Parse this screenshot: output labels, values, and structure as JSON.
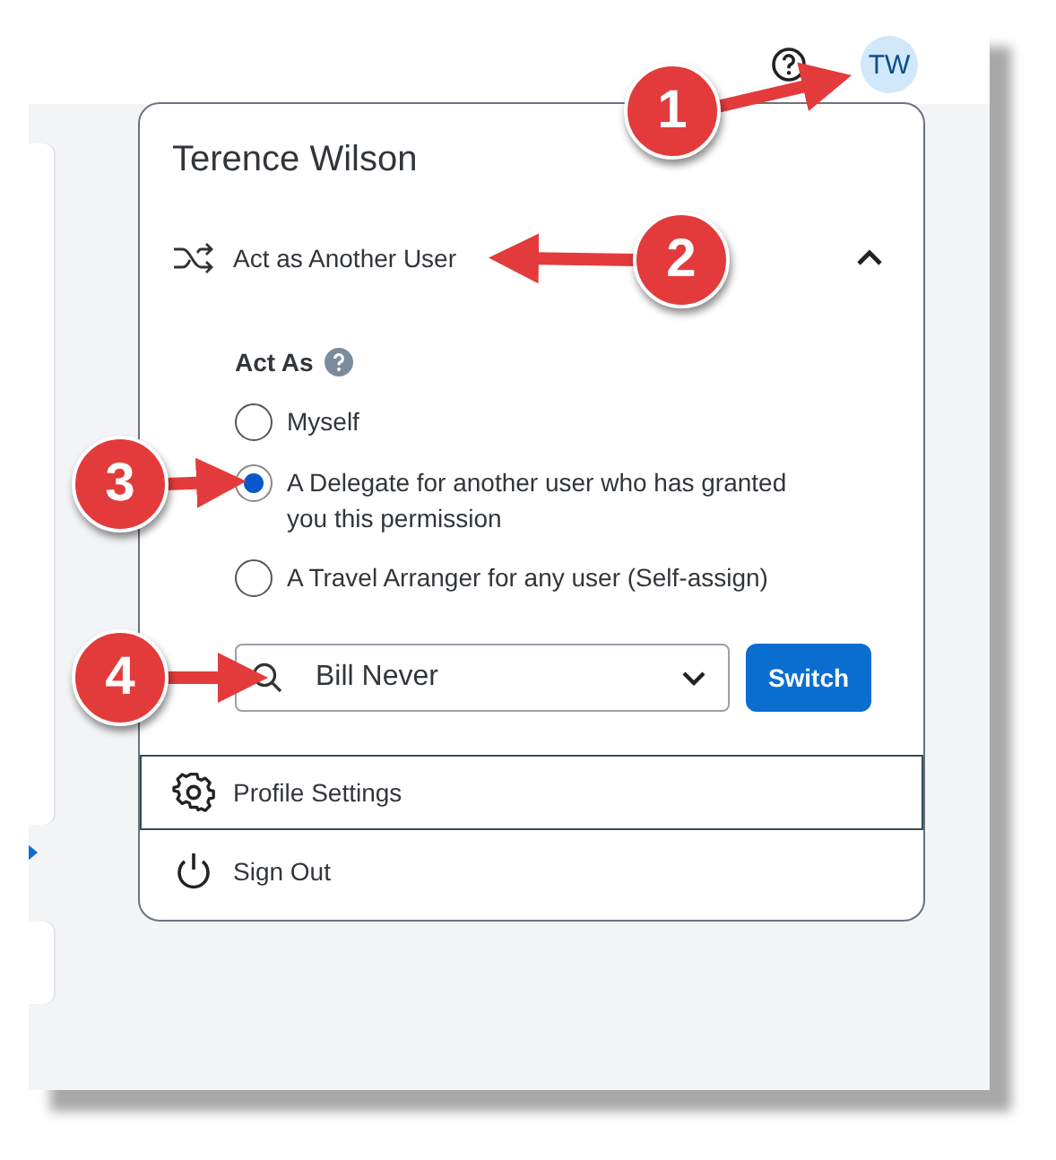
{
  "header": {
    "avatar": "TW"
  },
  "menu": {
    "user_name": "Terence Wilson",
    "act_as_another": {
      "label": "Act as Another User",
      "expanded": true
    },
    "act_as": {
      "label": "Act As",
      "options": [
        {
          "label": "Myself",
          "selected": false
        },
        {
          "label": "A Delegate for another user who has granted you this permission",
          "selected": true
        },
        {
          "label": "A Travel Arranger for any user (Self-assign)",
          "selected": false
        }
      ]
    },
    "user_search": {
      "value": "Bill Never"
    },
    "switch_button": "Switch",
    "items": [
      {
        "label": "Profile Settings",
        "kind": "settings",
        "focused": true
      },
      {
        "label": "Sign Out",
        "kind": "signout",
        "focused": false
      }
    ]
  },
  "callouts": [
    {
      "number": "1"
    },
    {
      "number": "2"
    },
    {
      "number": "3"
    },
    {
      "number": "4"
    }
  ]
}
